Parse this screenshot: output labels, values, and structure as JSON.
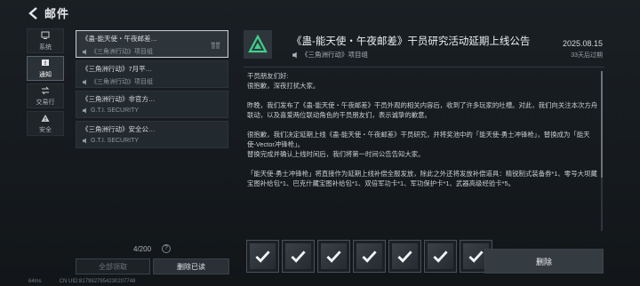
{
  "header": {
    "title": "邮件"
  },
  "sidebar": {
    "items": [
      {
        "label": "系统",
        "icon": "monitor-icon"
      },
      {
        "label": "通知",
        "icon": "alert-icon"
      },
      {
        "label": "交易行",
        "icon": "trade-icon"
      },
      {
        "label": "安全",
        "icon": "warning-icon"
      }
    ]
  },
  "mails": [
    {
      "subject": "《蛊-能天使・午夜邮差…",
      "sender": "《三角洲行动》项目组"
    },
    {
      "subject": "《三角洲行动》7月平…",
      "sender": "《三角洲行动》项目组"
    },
    {
      "subject": "《三角洲行动》非官方…",
      "sender": "G.T.I. SECURITY"
    },
    {
      "subject": "《三角洲行动》安全公…",
      "sender": "G.T.I. SECURITY"
    }
  ],
  "list_footer": {
    "counter": "4/200",
    "help": "?",
    "claim_all": "全部领取",
    "delete_read": "删除已读"
  },
  "status": {
    "ping": "64ms",
    "uid": "CN UID:8179827954230207748"
  },
  "message": {
    "title": "《蛊-能天使・午夜邮差》干员研究活动延期上线公告",
    "sender": "《三角洲行动》项目组",
    "date": "2025.08.15",
    "expire": "33天后过期",
    "paragraphs": [
      "干员朋友们好:\n很抱歉，深夜打扰大家。",
      "昨晚，我们发布了《蛊-能天使・午夜邮差》干员外观的相关内容后，收到了许多玩家的吐槽。对此，我们向关注本次方舟联动，以及喜爱两位联动角色的干员朋友们，表示诚挚的歉意。",
      "很抱歉，我们决定延期上线《蛊-能天使・午夜邮差》干员研究，并将奖池中的「能天使-勇士冲锋枪」，替换成为「能天使-Vector冲锋枪」。\n替换完成并确认上线时间后，我们将第一时间公告告知大家。",
      "「能天使-勇士冲锋枪」将直接作为延期上线补偿全服发放，除此之外还将发放补偿道具：精锐制式装备券*1、零号大坝藏宝图补给包*1、巴克什藏宝图补给包*1、双倍军功卡*1、军功保护卡*1、武器高级经验卡*5。"
    ]
  },
  "rewards_count": 7,
  "delete_label": "删除"
}
